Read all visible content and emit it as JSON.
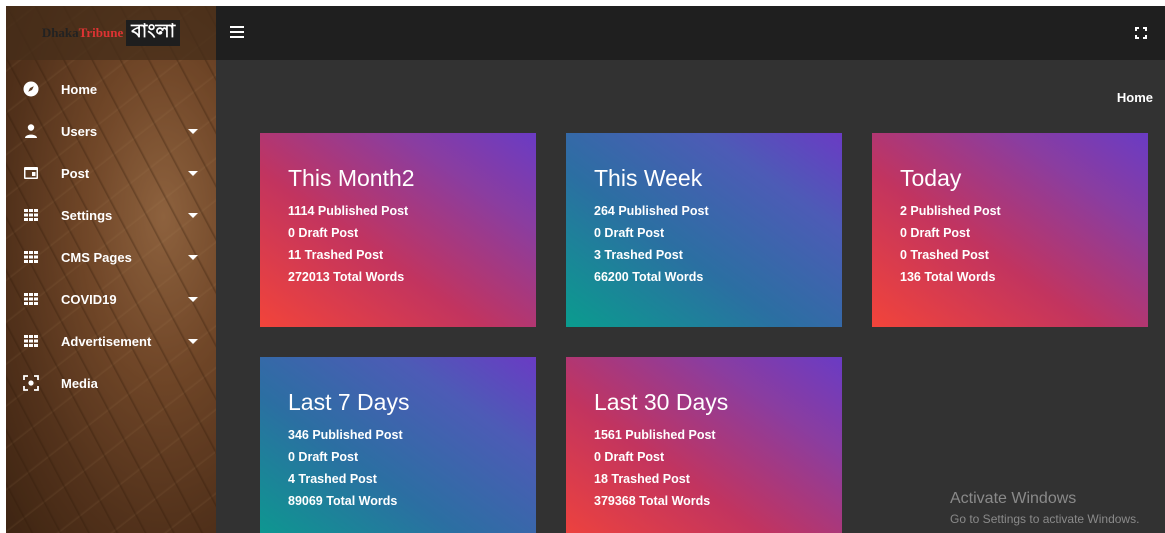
{
  "brand": {
    "name_part1": "Dhaka",
    "name_part2": "Tribune",
    "bangla": "বাংলা"
  },
  "sidebar": {
    "items": [
      {
        "label": "Home",
        "icon": "compass-icon",
        "has_caret": false
      },
      {
        "label": "Users",
        "icon": "person-icon",
        "has_caret": true
      },
      {
        "label": "Post",
        "icon": "card-icon",
        "has_caret": true
      },
      {
        "label": "Settings",
        "icon": "grid-icon",
        "has_caret": true
      },
      {
        "label": "CMS Pages",
        "icon": "grid-icon",
        "has_caret": true
      },
      {
        "label": "COVID19",
        "icon": "grid-icon",
        "has_caret": true
      },
      {
        "label": "Advertisement",
        "icon": "grid-icon",
        "has_caret": true
      },
      {
        "label": "Media",
        "icon": "focus-icon",
        "has_caret": false
      }
    ]
  },
  "breadcrumb": "Home",
  "cards": [
    {
      "title": "This Month2",
      "published": "1114 Published Post",
      "draft": "0 Draft Post",
      "trashed": "11 Trashed Post",
      "words": "272013 Total Words"
    },
    {
      "title": "This Week",
      "published": "264 Published Post",
      "draft": "0 Draft Post",
      "trashed": "3 Trashed Post",
      "words": "66200 Total Words"
    },
    {
      "title": "Today",
      "published": "2 Published Post",
      "draft": "0 Draft Post",
      "trashed": "0 Trashed Post",
      "words": "136 Total Words"
    },
    {
      "title": "Last 7 Days",
      "published": "346 Published Post",
      "draft": "0 Draft Post",
      "trashed": "4 Trashed Post",
      "words": "89069 Total Words"
    },
    {
      "title": "Last 30 Days",
      "published": "1561 Published Post",
      "draft": "0 Draft Post",
      "trashed": "18 Trashed Post",
      "words": "379368 Total Words"
    }
  ],
  "watermark": {
    "line1": "Activate Windows",
    "line2": "Go to Settings to activate Windows."
  }
}
